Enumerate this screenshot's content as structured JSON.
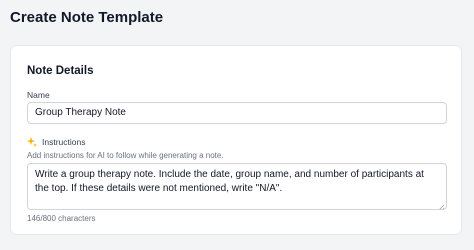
{
  "page": {
    "title": "Create Note Template"
  },
  "note_details": {
    "section_title": "Note Details",
    "name": {
      "label": "Name",
      "value": "Group Therapy Note"
    },
    "instructions": {
      "icon": "sparkle-icon",
      "label": "Instructions",
      "helper": "Add instructions for AI to follow while generating a note.",
      "value": "Write a group therapy note. Include the date, group name, and number of participants at the top. If these details were not mentioned, write \"N/A\".",
      "counter": "146/800 characters"
    }
  },
  "colors": {
    "sparkle": "#f5b301"
  }
}
